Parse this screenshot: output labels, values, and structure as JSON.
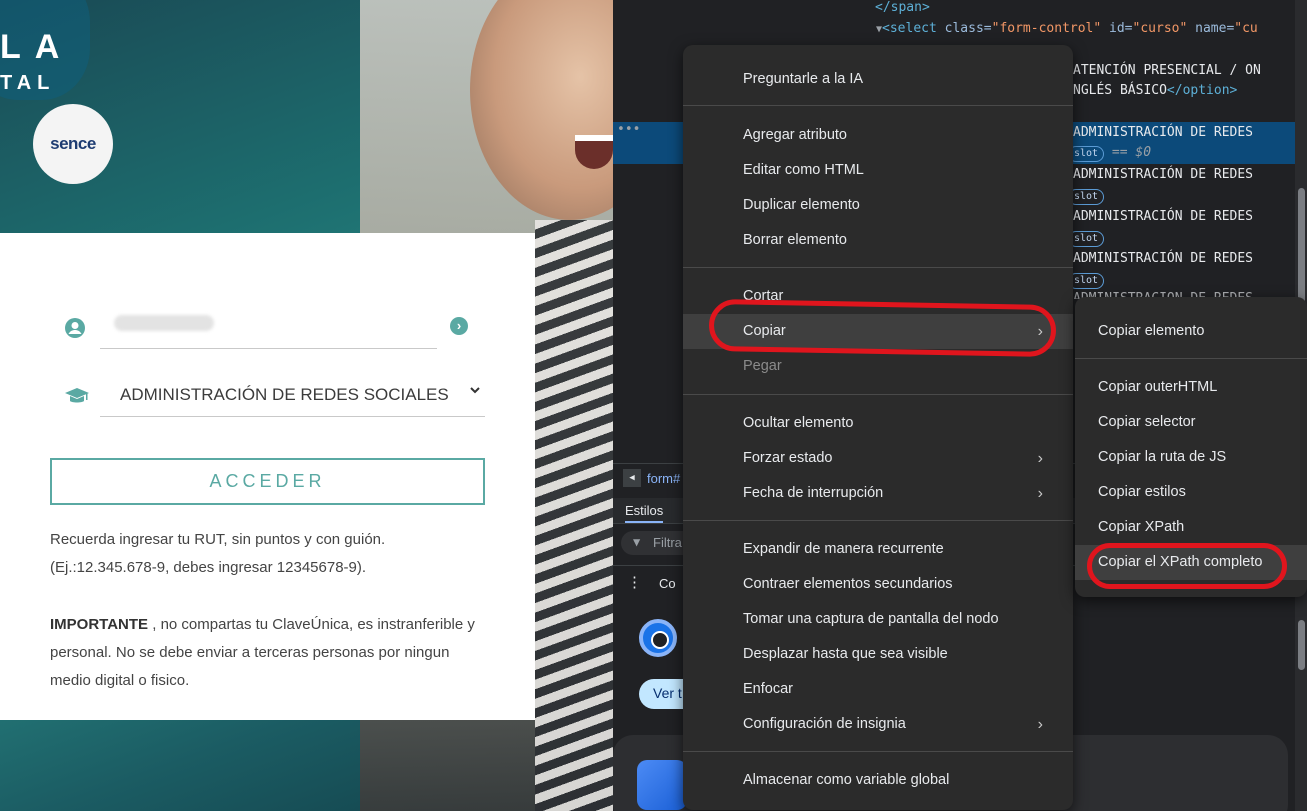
{
  "login_page": {
    "logo_line_1": "LA",
    "logo_line_2": "TAL",
    "sence_logo": "sence",
    "rut_input_value": "",
    "course_select_value": "ADMINISTRACIÓN DE REDES SOCIALES",
    "acceder_button": "ACCEDER",
    "info_rut": "Recuerda ingresar tu RUT, sin puntos y con guión. (Ej.:12.345.678-9, debes ingresar 12345678-9).",
    "info_important_label": "IMPORTANTE",
    "info_important_text": " , no compartas tu ClaveÚnica, es instranferible y personal. No se debe enviar a terceras personas por ningun medio digital o fisico.",
    "icons": [
      "user-circle-icon",
      "arrow-right-circle-icon",
      "graduation-cap-icon",
      "chevron-down-icon"
    ]
  },
  "devtools": {
    "code_lines": {
      "span_close": "</span>",
      "select_open_tag": "<select",
      "select_class_attr": "class=",
      "select_class_val": "\"form-control\"",
      "select_id_attr": "id=",
      "select_id_val": "\"curso\"",
      "select_name_attr": "name=",
      "select_name_val": "\"cu",
      "option_1_a": "ATENCIÓN PRESENCIAL / ON",
      "option_1_b": "NGLÉS BÁSICO",
      "option_close": "</option>",
      "option_admin": "ADMINISTRACIÓN DE REDES",
      "option_admin_partial": "ADMINISTRACIÓN DE REDES",
      "selected_marker": "== $0",
      "slot_badge": "slot"
    },
    "breadcrumb": "form#",
    "styles_tab": "Estilos",
    "filter_placeholder": "Filtra",
    "more_text": "Co",
    "ver_button": "Ver t"
  },
  "context_menu": {
    "items": [
      {
        "label": "Preguntarle a la IA"
      },
      {
        "label": "Agregar atributo"
      },
      {
        "label": "Editar como HTML"
      },
      {
        "label": "Duplicar elemento"
      },
      {
        "label": "Borrar elemento"
      },
      {
        "label": "Cortar"
      },
      {
        "label": "Copiar"
      },
      {
        "label": "Pegar"
      },
      {
        "label": "Ocultar elemento"
      },
      {
        "label": "Forzar estado"
      },
      {
        "label": "Fecha de interrupción"
      },
      {
        "label": "Expandir de manera recurrente"
      },
      {
        "label": "Contraer elementos secundarios"
      },
      {
        "label": "Tomar una captura de pantalla del nodo"
      },
      {
        "label": "Desplazar hasta que sea visible"
      },
      {
        "label": "Enfocar"
      },
      {
        "label": "Configuración de insignia"
      },
      {
        "label": "Almacenar como variable global"
      }
    ]
  },
  "copy_submenu": {
    "items": [
      {
        "label": "Copiar elemento"
      },
      {
        "label": "Copiar outerHTML"
      },
      {
        "label": "Copiar selector"
      },
      {
        "label": "Copiar la ruta de JS"
      },
      {
        "label": "Copiar estilos"
      },
      {
        "label": "Copiar XPath"
      },
      {
        "label": "Copiar el XPath completo"
      }
    ]
  },
  "colors": {
    "accent_teal": "#5aa9a3",
    "annotation_red": "#e0151d",
    "devtools_selected": "#0c4a7a"
  }
}
